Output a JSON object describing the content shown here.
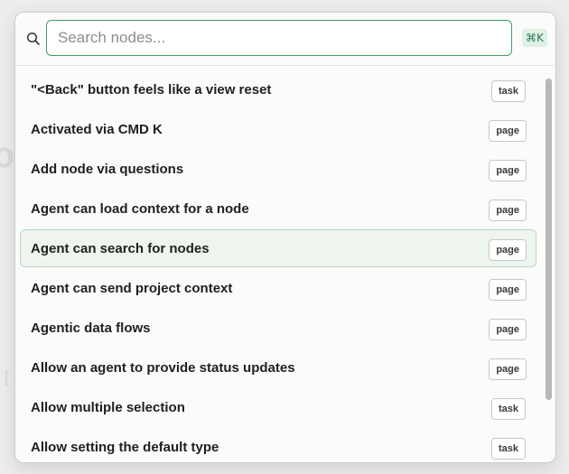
{
  "search": {
    "placeholder": "Search nodes...",
    "value": "",
    "shortcut": "⌘K"
  },
  "results": [
    {
      "title": "\"<Back\" button feels like a view reset",
      "type": "task",
      "selected": false
    },
    {
      "title": "Activated via CMD K",
      "type": "page",
      "selected": false
    },
    {
      "title": "Add node via questions",
      "type": "page",
      "selected": false
    },
    {
      "title": "Agent can load context for a node",
      "type": "page",
      "selected": false
    },
    {
      "title": "Agent can search for nodes",
      "type": "page",
      "selected": true
    },
    {
      "title": "Agent can send project context",
      "type": "page",
      "selected": false
    },
    {
      "title": "Agentic data flows",
      "type": "page",
      "selected": false
    },
    {
      "title": "Allow an agent to provide status updates",
      "type": "page",
      "selected": false
    },
    {
      "title": "Allow multiple selection",
      "type": "task",
      "selected": false
    },
    {
      "title": "Allow setting the default type",
      "type": "task",
      "selected": false
    }
  ],
  "colors": {
    "accent": "#3f9d6a",
    "selected_background": "#eef5ee",
    "shortcut_background": "#dff0e5"
  },
  "icons": {
    "search": "search-icon"
  }
}
